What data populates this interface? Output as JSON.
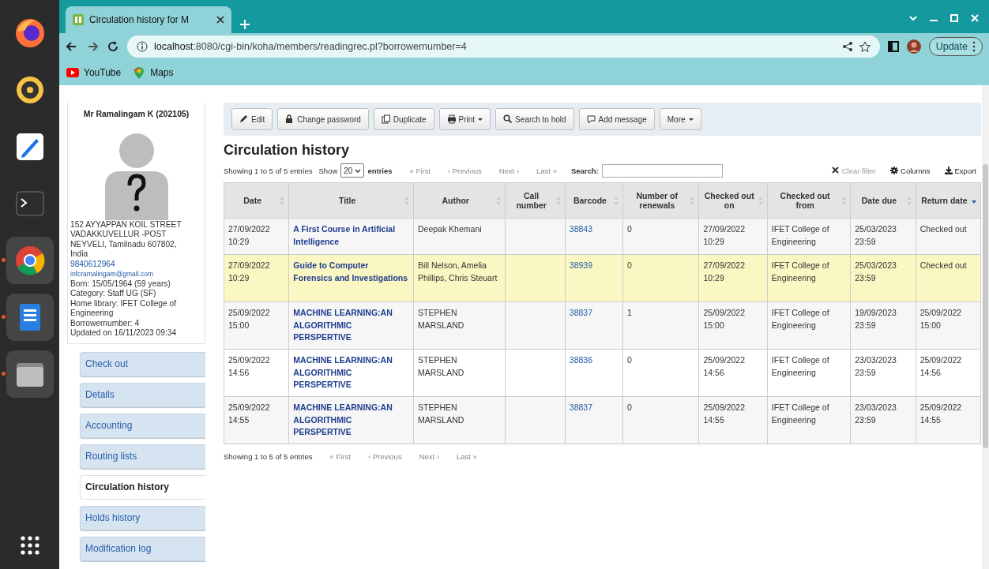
{
  "dock": {
    "apps": [
      {
        "kind": "firefox",
        "running": false
      },
      {
        "kind": "music",
        "running": false
      },
      {
        "kind": "editor",
        "running": false
      },
      {
        "kind": "terminal",
        "running": false
      },
      {
        "kind": "chrome",
        "running": true
      },
      {
        "kind": "document",
        "running": true
      },
      {
        "kind": "files",
        "running": true
      }
    ]
  },
  "browser": {
    "tab": {
      "title": "Circulation history for M"
    },
    "url": {
      "host": "localhost",
      "path": ":8080/cgi-bin/koha/members/readingrec.pl?borrowernumber=4"
    },
    "update_button": "Update",
    "bookmarks": [
      {
        "kind": "youtube",
        "label": "YouTube"
      },
      {
        "kind": "maps",
        "label": "Maps"
      }
    ]
  },
  "patron": {
    "name": "Mr Ramalingam K (202105)",
    "address": [
      "152 AYYAPPAN KOIL STREET",
      "VADAKKUVELLUR -POST",
      "NEYVELI, Tamilnadu 607802,",
      "India"
    ],
    "phone": "9840612964",
    "email": "infcramalingam@gmail.com",
    "details": [
      "Born: 15/05/1964 (59 years)",
      "Category: Staff UG (SF)",
      "Home library: IFET College of Engineering",
      "Borrowernumber: 4",
      "Updated on 16/11/2023 09:34"
    ]
  },
  "sidebar": {
    "items": [
      {
        "label": "Check out",
        "selected": false
      },
      {
        "label": "Details",
        "selected": false
      },
      {
        "label": "Accounting",
        "selected": false
      },
      {
        "label": "Routing lists",
        "selected": false
      },
      {
        "label": "Circulation history",
        "selected": true
      },
      {
        "label": "Holds history",
        "selected": false
      },
      {
        "label": "Modification log",
        "selected": false
      }
    ]
  },
  "toolbar": {
    "buttons": [
      {
        "kind": "edit",
        "label": "Edit",
        "dropdown": false
      },
      {
        "kind": "lock",
        "label": "Change password",
        "dropdown": false
      },
      {
        "kind": "copy",
        "label": "Duplicate",
        "dropdown": false
      },
      {
        "kind": "print",
        "label": "Print",
        "dropdown": true
      },
      {
        "kind": "search",
        "label": "Search to hold",
        "dropdown": false
      },
      {
        "kind": "comment",
        "label": "Add message",
        "dropdown": false
      },
      {
        "kind": "none",
        "label": "More",
        "dropdown": true
      }
    ]
  },
  "heading": "Circulation history",
  "table_controls": {
    "info": "Showing 1 to 5 of 5 entries",
    "show_label": "Show",
    "page_size": "20",
    "entries_label": "entries",
    "pager": [
      {
        "label": "« First",
        "disabled": true
      },
      {
        "label": "‹ Previous",
        "disabled": true
      },
      {
        "label": "Next ›",
        "disabled": true
      },
      {
        "label": "Last »",
        "disabled": true
      }
    ],
    "search_label": "Search:",
    "tools": [
      {
        "kind": "clear",
        "label": "Clear filter",
        "disabled": true
      },
      {
        "kind": "columns",
        "label": "Columns",
        "disabled": false
      },
      {
        "kind": "export",
        "label": "Export",
        "disabled": false
      }
    ]
  },
  "table": {
    "columns": [
      {
        "label": "Date",
        "sorted": false
      },
      {
        "label": "Title",
        "sorted": false
      },
      {
        "label": "Author",
        "sorted": false
      },
      {
        "label": "Call number",
        "sorted": false
      },
      {
        "label": "Barcode",
        "sorted": false
      },
      {
        "label": "Number of renewals",
        "sorted": false
      },
      {
        "label": "Checked out on",
        "sorted": false
      },
      {
        "label": "Checked out from",
        "sorted": false
      },
      {
        "label": "Date due",
        "sorted": false
      },
      {
        "label": "Return date",
        "sorted": true
      }
    ],
    "rows": [
      {
        "highlighted": false,
        "cells": [
          "27/09/2022 10:29",
          "A First Course in Artificial Intelligence",
          "Deepak Khemani",
          "",
          "38843",
          "0",
          "27/09/2022 10:29",
          "IFET College of Engineering",
          "25/03/2023 23:59",
          "Checked out"
        ]
      },
      {
        "highlighted": true,
        "cells": [
          "27/09/2022 10:29",
          "Guide to Computer Forensics and Investigations",
          "Bill Nelson, Amelia Phillips, Chris Steuart",
          "",
          "38939",
          "0",
          "27/09/2022 10:29",
          "IFET College of Engineering",
          "25/03/2023 23:59",
          "Checked out"
        ]
      },
      {
        "highlighted": false,
        "cells": [
          "25/09/2022 15:00",
          "MACHINE LEARNING:AN ALGORITHMIC PERSPERTIVE",
          "STEPHEN MARSLAND",
          "",
          "38837",
          "1",
          "25/09/2022 15:00",
          "IFET College of Engineering",
          "19/09/2023 23:59",
          "25/09/2022 15:00"
        ]
      },
      {
        "highlighted": false,
        "cells": [
          "25/09/2022 14:56",
          "MACHINE LEARNING:AN ALGORITHMIC PERSPERTIVE",
          "STEPHEN MARSLAND",
          "",
          "38836",
          "0",
          "25/09/2022 14:56",
          "IFET College of Engineering",
          "23/03/2023 23:59",
          "25/09/2022 14:56"
        ]
      },
      {
        "highlighted": false,
        "cells": [
          "25/09/2022 14:55",
          "MACHINE LEARNING:AN ALGORITHMIC PERSPERTIVE",
          "STEPHEN MARSLAND",
          "",
          "38837",
          "0",
          "25/09/2022 14:55",
          "IFET College of Engineering",
          "23/03/2023 23:59",
          "25/09/2022 14:55"
        ]
      }
    ]
  },
  "footer_controls": {
    "info": "Showing 1 to 5 of 5 entries",
    "pager": [
      {
        "label": "« First",
        "disabled": true
      },
      {
        "label": "‹ Previous",
        "disabled": true
      },
      {
        "label": "Next ›",
        "disabled": true
      },
      {
        "label": "Last »",
        "disabled": true
      }
    ]
  }
}
